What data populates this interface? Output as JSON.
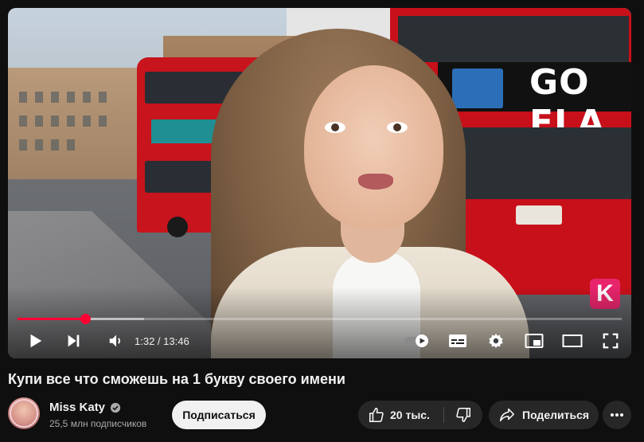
{
  "player": {
    "time_current": "1:32",
    "time_total": "13:46",
    "time_separator": " / ",
    "progress_fraction": 0.1114,
    "buffered_fraction": 0.21,
    "accent_color": "#ff0033",
    "bus_ad_text": "GO FLA",
    "channel_watermark": "K",
    "controls": {
      "play_icon": "play-icon",
      "next_icon": "next-icon",
      "volume_icon": "volume-icon",
      "autoplay_icon": "autoplay-toggle-icon",
      "subtitles_icon": "subtitles-icon",
      "settings_icon": "gear-icon",
      "miniplayer_icon": "miniplayer-icon",
      "theater_icon": "theater-mode-icon",
      "fullscreen_icon": "fullscreen-icon"
    }
  },
  "video": {
    "title": "Купи все что сможешь на 1 букву своего имени"
  },
  "channel": {
    "name": "Miss Katy",
    "subscribers": "25,5 млн подписчиков",
    "verified_icon": "verified-check-icon"
  },
  "actions": {
    "subscribe_label": "Подписаться",
    "like_count": "20 тыс.",
    "like_icon": "thumbs-up-icon",
    "dislike_icon": "thumbs-down-icon",
    "share_label": "Поделиться",
    "share_icon": "share-arrow-icon",
    "more_icon": "more-horizontal-icon"
  }
}
